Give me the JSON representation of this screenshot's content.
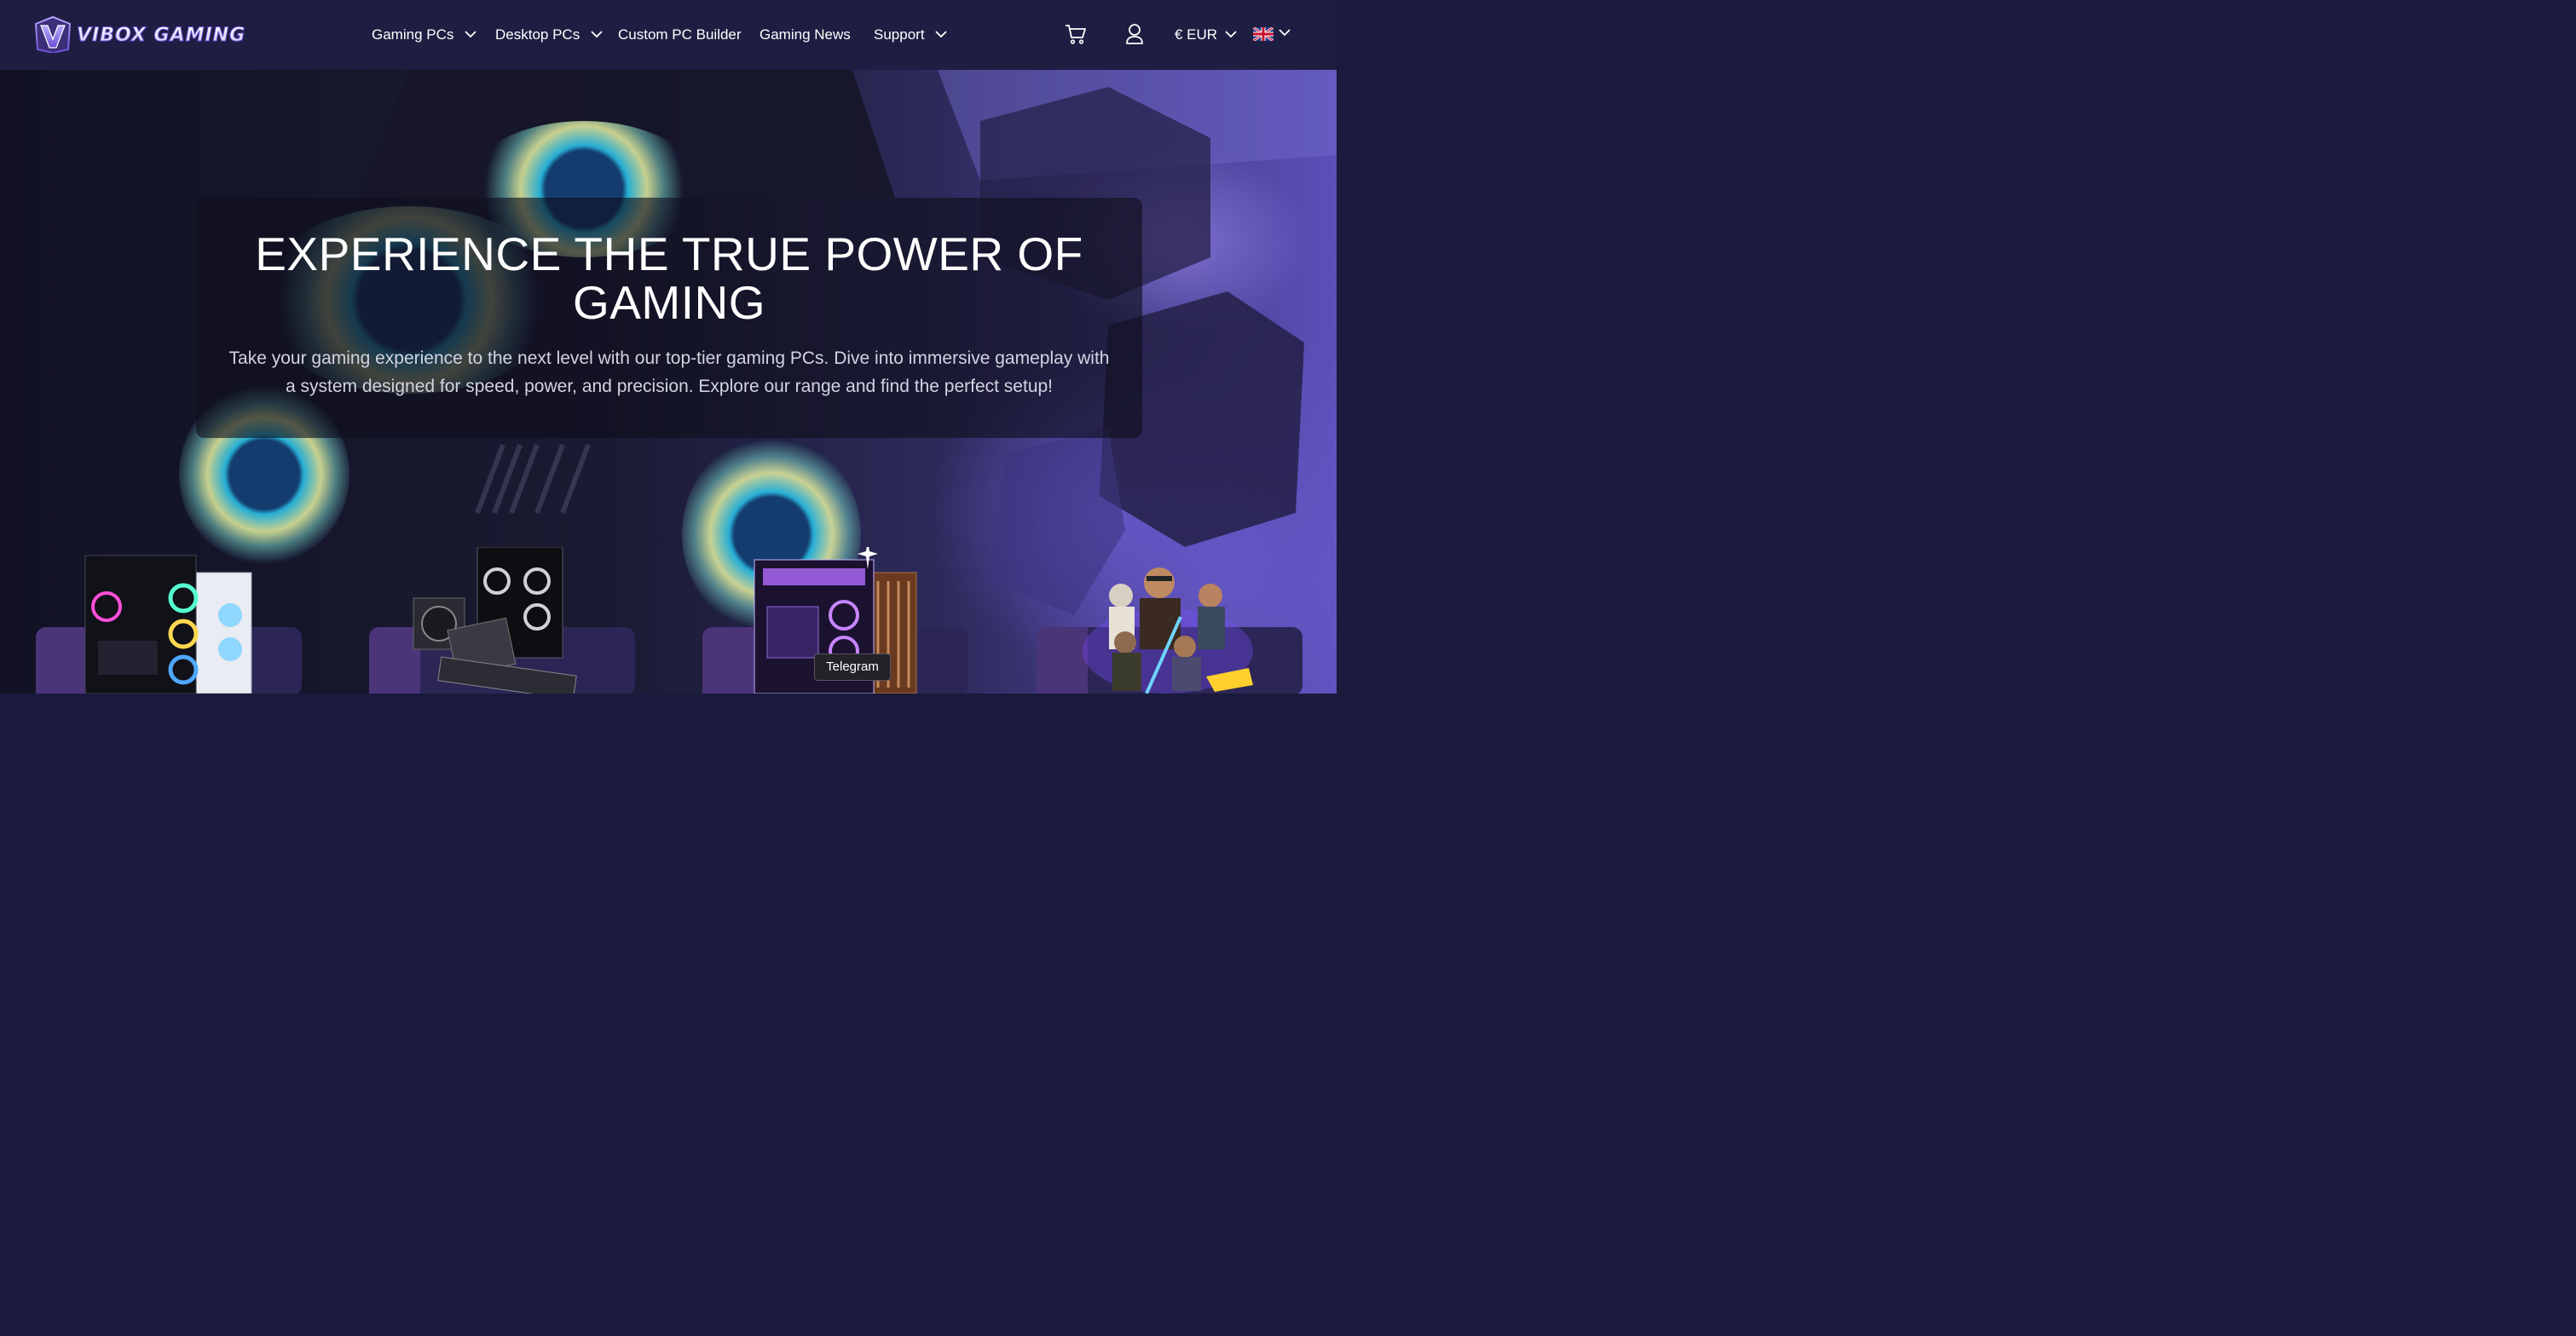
{
  "header": {
    "brand_name": "VIBOX GAMING",
    "nav": [
      {
        "label": "Gaming PCs",
        "has_dropdown": true
      },
      {
        "label": "Desktop PCs",
        "has_dropdown": true
      },
      {
        "label": "Custom PC Builder",
        "has_dropdown": false
      },
      {
        "label": "Gaming News",
        "has_dropdown": false
      },
      {
        "label": "Support",
        "has_dropdown": true
      }
    ],
    "cart_icon": "cart-icon",
    "account_icon": "user-icon",
    "currency": "€ EUR",
    "language_flag": "uk-flag-icon"
  },
  "hero": {
    "title": "EXPERIENCE THE TRUE POWER OF GAMING",
    "text": "Take your gaming experience to the next level with our top-tier gaming PCs. Dive into immersive gameplay with a system designed for speed, power, and precision. Explore our range and find the perfect setup!"
  },
  "categories": [
    {
      "image": "gaming-pc-cases-image"
    },
    {
      "image": "pc-components-image"
    },
    {
      "image": "custom-pc-image"
    },
    {
      "image": "games-characters-image"
    }
  ],
  "tooltip": {
    "label": "Telegram"
  },
  "colors": {
    "header_bg": "#1e1e42",
    "card_bg": "#2c2656",
    "accent_purple": "#7d5cff",
    "text_white": "#ffffff"
  }
}
